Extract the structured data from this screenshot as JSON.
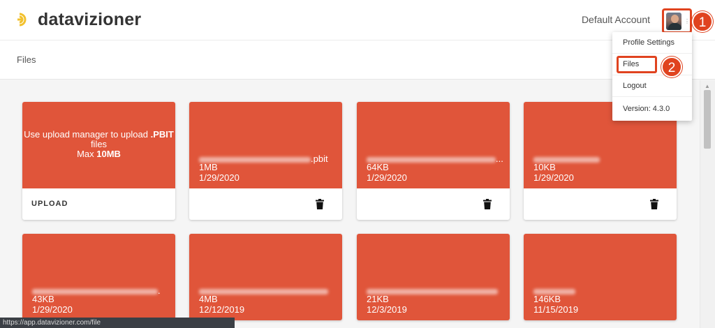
{
  "header": {
    "logo_text": "datavizioner",
    "account_name": "Default Account",
    "avatar_caret": "⋮"
  },
  "subheader": {
    "title": "Files"
  },
  "menu": {
    "items": [
      {
        "label": "Profile Settings"
      },
      {
        "label": "Files"
      },
      {
        "label": "Logout"
      },
      {
        "label": "Version: 4.3.0"
      }
    ]
  },
  "callouts": {
    "first": "1",
    "second": "2"
  },
  "upload_card": {
    "line1_prefix": "Use upload manager to upload ",
    "line1_bold": ".PBIT",
    "line2": "files",
    "line3_prefix": "Max ",
    "line3_bold": "10MB",
    "button_label": "UPLOAD"
  },
  "files": [
    {
      "name_suffix": ".pbit",
      "size": "1MB",
      "date": "1/29/2020"
    },
    {
      "name_suffix": "...",
      "size": "64KB",
      "date": "1/29/2020"
    },
    {
      "name_suffix": "",
      "size": "10KB",
      "date": "1/29/2020"
    },
    {
      "name_suffix": ".",
      "size": "43KB",
      "date": "1/29/2020"
    },
    {
      "name_suffix": "",
      "size": "4MB",
      "date": "12/12/2019"
    },
    {
      "name_suffix": "",
      "size": "21KB",
      "date": "12/3/2019"
    },
    {
      "name_suffix": "",
      "size": "146KB",
      "date": "11/15/2019"
    }
  ],
  "status_bar": {
    "url": "https://app.datavizioner.com/file"
  },
  "colors": {
    "accent": "#e0431f",
    "card": "#e0553a",
    "brand_yellow": "#f2c12e"
  },
  "icons": {
    "delete": "trash-icon",
    "logo": "logo-mark-icon"
  }
}
